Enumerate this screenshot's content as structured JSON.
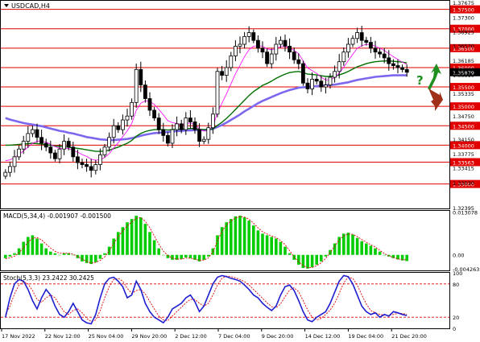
{
  "symbol_title": "USDCAD,H4",
  "macd_label": "MACD(5,34,4) -0.001907 -0.001500",
  "stoch_label": "Stoch(5,3,3) 23.2422 30.2425",
  "colors": {
    "bg": "#ffffff",
    "border": "#000000",
    "candle": "#000000",
    "bull_fill": "#ffffff",
    "bear_fill": "#000000",
    "level_line": "#e00000",
    "level_box": "#e00000",
    "ma_fast": "#ff00ff",
    "ma_mid": "#007000",
    "ma_slow": "#7b68ee",
    "current_price_box": "#000000",
    "macd_hist": "#00cc00",
    "macd_signal": "#e00000",
    "stoch_main": "#1f1fd0",
    "stoch_signal": "#e00000",
    "stoch_level": "#e00000",
    "arrow_up": "#1f8f1f",
    "arrow_down": "#a0301a",
    "question": "#1f8f1f"
  },
  "chart_data": [
    {
      "type": "candlestick",
      "title": "USDCAD,H4",
      "ylim": [
        1.3237,
        1.3772
      ],
      "price_axis_labels": [
        "1.37675",
        "1.37300",
        "1.36925",
        "1.36570",
        "1.36185",
        "1.35810",
        "1.35335",
        "1.34750",
        "1.34150",
        "1.33775",
        "1.33415",
        "1.33030",
        "1.32395"
      ],
      "levels": [
        "1.37500",
        "1.37000",
        "1.36500",
        "1.36000",
        "1.35500",
        "1.35000",
        "1.34500",
        "1.34000",
        "1.33563",
        "1.33000"
      ],
      "current_price": "1.35879",
      "x_labels": [
        "17 Nov 2022",
        "22 Nov 12:00",
        "25 Nov 04:00",
        "29 Nov 20:00",
        "2 Dec 12:00",
        "7 Dec 04:00",
        "9 Dec 20:00",
        "14 Dec 12:00",
        "19 Dec 04:00",
        "21 Dec 20:00"
      ],
      "closes": [
        1.333,
        1.3345,
        1.337,
        1.339,
        1.341,
        1.343,
        1.344,
        1.342,
        1.3405,
        1.3395,
        1.338,
        1.3365,
        1.339,
        1.341,
        1.3395,
        1.337,
        1.3355,
        1.335,
        1.3345,
        1.3335,
        1.335,
        1.3375,
        1.3395,
        1.342,
        1.345,
        1.344,
        1.3465,
        1.3475,
        1.351,
        1.3595,
        1.3555,
        1.352,
        1.349,
        1.347,
        1.344,
        1.3425,
        1.3405,
        1.344,
        1.3455,
        1.344,
        1.347,
        1.346,
        1.344,
        1.341,
        1.3415,
        1.3445,
        1.348,
        1.359,
        1.358,
        1.36,
        1.363,
        1.3655,
        1.366,
        1.368,
        1.369,
        1.367,
        1.365,
        1.364,
        1.361,
        1.3635,
        1.366,
        1.367,
        1.3655,
        1.364,
        1.362,
        1.361,
        1.356,
        1.3545,
        1.357,
        1.3565,
        1.355,
        1.3555,
        1.3575,
        1.359,
        1.3615,
        1.364,
        1.366,
        1.3675,
        1.369,
        1.367,
        1.3665,
        1.365,
        1.364,
        1.3635,
        1.3625,
        1.361,
        1.3605,
        1.36,
        1.3595,
        1.35879
      ],
      "ma_fast": [
        1.336,
        1.3362,
        1.3368,
        1.3376,
        1.3385,
        1.3395,
        1.3405,
        1.341,
        1.341,
        1.3408,
        1.3402,
        1.3396,
        1.3392,
        1.3392,
        1.3391,
        1.3387,
        1.3382,
        1.3376,
        1.3371,
        1.3364,
        1.3361,
        1.3363,
        1.3368,
        1.3378,
        1.3393,
        1.3406,
        1.3422,
        1.3437,
        1.3456,
        1.349,
        1.3508,
        1.3514,
        1.3513,
        1.3505,
        1.3492,
        1.3478,
        1.3463,
        1.3458,
        1.3456,
        1.3452,
        1.3456,
        1.3457,
        1.3453,
        1.3442,
        1.3436,
        1.3438,
        1.3448,
        1.3484,
        1.3508,
        1.3532,
        1.3558,
        1.3584,
        1.3606,
        1.3628,
        1.3646,
        1.3655,
        1.3656,
        1.3655,
        1.3648,
        1.3646,
        1.3649,
        1.3654,
        1.3654,
        1.3651,
        1.3644,
        1.3636,
        1.3617,
        1.3599,
        1.3592,
        1.3585,
        1.3575,
        1.3568,
        1.3569,
        1.3574,
        1.3586,
        1.3601,
        1.3618,
        1.3634,
        1.365,
        1.3656,
        1.366,
        1.3659,
        1.3655,
        1.365,
        1.3644,
        1.3636,
        1.3628,
        1.3621,
        1.3614,
        1.3608
      ],
      "ma_mid": [
        1.34,
        1.34,
        1.3401,
        1.3402,
        1.3403,
        1.3404,
        1.3405,
        1.3404,
        1.3403,
        1.3401,
        1.34,
        1.3398,
        1.3397,
        1.3396,
        1.3395,
        1.3393,
        1.3392,
        1.339,
        1.3388,
        1.3386,
        1.3384,
        1.3384,
        1.3385,
        1.3387,
        1.3391,
        1.3395,
        1.34,
        1.3405,
        1.3412,
        1.3423,
        1.343,
        1.3435,
        1.3438,
        1.344,
        1.344,
        1.344,
        1.3439,
        1.344,
        1.3441,
        1.3441,
        1.3442,
        1.3443,
        1.3443,
        1.3441,
        1.344,
        1.344,
        1.3442,
        1.3451,
        1.3459,
        1.3469,
        1.348,
        1.3492,
        1.3504,
        1.3516,
        1.3528,
        1.3538,
        1.3546,
        1.3554,
        1.3559,
        1.3565,
        1.3572,
        1.3578,
        1.3583,
        1.3587,
        1.3589,
        1.359,
        1.3587,
        1.3583,
        1.3582,
        1.3581,
        1.3579,
        1.3577,
        1.3577,
        1.3578,
        1.3581,
        1.3585,
        1.359,
        1.3596,
        1.3602,
        1.3606,
        1.361,
        1.3613,
        1.3615,
        1.3616,
        1.3617,
        1.3617,
        1.3616,
        1.3615,
        1.3614,
        1.3612
      ],
      "ma_slow": [
        1.347,
        1.3466,
        1.3463,
        1.346,
        1.3457,
        1.3455,
        1.3453,
        1.3451,
        1.3449,
        1.3446,
        1.3443,
        1.344,
        1.3437,
        1.3435,
        1.3432,
        1.343,
        1.3427,
        1.3424,
        1.3421,
        1.3419,
        1.3417,
        1.3415,
        1.3414,
        1.3413,
        1.3413,
        1.3414,
        1.3415,
        1.3416,
        1.3418,
        1.3421,
        1.3424,
        1.3427,
        1.3429,
        1.3431,
        1.3432,
        1.3433,
        1.3434,
        1.3435,
        1.3436,
        1.3437,
        1.3438,
        1.3438,
        1.3439,
        1.3439,
        1.3439,
        1.344,
        1.3442,
        1.3447,
        1.3452,
        1.3458,
        1.3465,
        1.3472,
        1.3479,
        1.3487,
        1.3494,
        1.3501,
        1.3508,
        1.3514,
        1.3519,
        1.3524,
        1.3529,
        1.3534,
        1.3538,
        1.3542,
        1.3545,
        1.3548,
        1.3549,
        1.355,
        1.3551,
        1.3552,
        1.3553,
        1.3554,
        1.3555,
        1.3556,
        1.3558,
        1.356,
        1.3562,
        1.3565,
        1.3568,
        1.357,
        1.3572,
        1.3574,
        1.3576,
        1.3577,
        1.3578,
        1.3579,
        1.358,
        1.358,
        1.358,
        1.358
      ]
    },
    {
      "type": "bar",
      "title": "MACD(5,34,4) -0.001907 -0.001500",
      "ylim": [
        -0.00475,
        0.0135
      ],
      "axis_labels": [
        "0.013078",
        "0.00",
        "-0.004263"
      ],
      "histogram": [
        -0.001,
        -0.0005,
        0.0005,
        0.002,
        0.004,
        0.0055,
        0.006,
        0.005,
        0.0035,
        0.002,
        0.001,
        0.0005,
        0.0,
        0.0005,
        0.0005,
        0.0,
        -0.001,
        -0.002,
        -0.0025,
        -0.0028,
        -0.0022,
        -0.0012,
        0.0005,
        0.0025,
        0.005,
        0.007,
        0.0085,
        0.01,
        0.011,
        0.012,
        0.0115,
        0.0095,
        0.007,
        0.0045,
        0.002,
        0.0,
        -0.001,
        -0.0015,
        -0.0015,
        -0.0012,
        -0.0008,
        -0.001,
        -0.0015,
        -0.002,
        -0.0015,
        -0.0005,
        0.002,
        0.006,
        0.0085,
        0.01,
        0.011,
        0.0118,
        0.012,
        0.0115,
        0.0105,
        0.009,
        0.0075,
        0.0065,
        0.006,
        0.0055,
        0.005,
        0.004,
        0.0025,
        0.0005,
        -0.0015,
        -0.003,
        -0.004,
        -0.0042,
        -0.0038,
        -0.003,
        -0.002,
        -0.0005,
        0.0015,
        0.0035,
        0.0055,
        0.0065,
        0.0068,
        0.0062,
        0.0052,
        0.0042,
        0.0035,
        0.0028,
        0.002,
        0.001,
        0.0,
        -0.0005,
        -0.001,
        -0.0014,
        -0.0017,
        -0.0019
      ],
      "signal": [
        -0.0012,
        -0.0009,
        -0.0004,
        0.0006,
        0.0022,
        0.0039,
        0.0051,
        0.0053,
        0.0046,
        0.0033,
        0.0021,
        0.0011,
        0.0005,
        0.0005,
        0.0005,
        0.0002,
        -0.0005,
        -0.0013,
        -0.002,
        -0.0025,
        -0.0023,
        -0.0017,
        -0.0006,
        0.0012,
        0.0035,
        0.0056,
        0.0073,
        0.0089,
        0.0101,
        0.0112,
        0.0114,
        0.0103,
        0.0083,
        0.0058,
        0.0033,
        0.0012,
        -0.0002,
        -0.001,
        -0.0013,
        -0.0013,
        -0.001,
        -0.001,
        -0.0013,
        -0.0017,
        -0.0016,
        -0.0009,
        0.0009,
        0.0043,
        0.0072,
        0.0092,
        0.0104,
        0.0113,
        0.0118,
        0.0116,
        0.0109,
        0.0097,
        0.0083,
        0.0071,
        0.0064,
        0.0058,
        0.0053,
        0.0044,
        0.0031,
        0.0013,
        -0.0006,
        -0.0021,
        -0.0033,
        -0.0039,
        -0.0039,
        -0.0033,
        -0.0024,
        -0.0011,
        0.0007,
        0.0027,
        0.0046,
        0.0058,
        0.0064,
        0.0063,
        0.0056,
        0.0047,
        0.0039,
        0.0031,
        0.0024,
        0.0014,
        0.0004,
        -0.0003,
        -0.0008,
        -0.0012,
        -0.0015,
        -0.0015
      ]
    },
    {
      "type": "line",
      "title": "Stoch(5,3,3) 23.2422 30.2425",
      "ylim": [
        0,
        100
      ],
      "axis_labels": [
        "100",
        "80",
        "20",
        "0"
      ],
      "levels": [
        80,
        20
      ],
      "main": [
        20,
        55,
        80,
        88,
        85,
        70,
        50,
        35,
        55,
        70,
        60,
        40,
        25,
        20,
        30,
        45,
        30,
        15,
        10,
        8,
        25,
        55,
        80,
        90,
        92,
        85,
        75,
        55,
        60,
        85,
        70,
        45,
        30,
        20,
        15,
        10,
        20,
        35,
        40,
        45,
        55,
        60,
        48,
        30,
        40,
        60,
        80,
        92,
        95,
        93,
        90,
        88,
        85,
        78,
        70,
        60,
        55,
        45,
        38,
        32,
        40,
        60,
        75,
        78,
        68,
        50,
        30,
        15,
        12,
        20,
        25,
        30,
        45,
        65,
        85,
        95,
        93,
        80,
        60,
        40,
        30,
        25,
        28,
        20,
        25,
        22,
        30,
        28,
        25,
        23
      ],
      "signal": [
        25,
        40,
        62,
        78,
        84,
        80,
        68,
        52,
        47,
        55,
        60,
        55,
        42,
        30,
        25,
        32,
        35,
        28,
        18,
        12,
        15,
        32,
        55,
        75,
        88,
        90,
        85,
        72,
        63,
        68,
        70,
        62,
        48,
        35,
        22,
        15,
        14,
        22,
        30,
        38,
        46,
        52,
        52,
        45,
        40,
        45,
        60,
        78,
        90,
        94,
        93,
        91,
        88,
        84,
        78,
        70,
        62,
        54,
        46,
        39,
        37,
        44,
        57,
        69,
        73,
        66,
        50,
        33,
        20,
        15,
        18,
        25,
        33,
        45,
        63,
        82,
        92,
        90,
        78,
        60,
        44,
        32,
        28,
        25,
        24,
        23,
        25,
        27,
        27,
        25
      ]
    }
  ]
}
